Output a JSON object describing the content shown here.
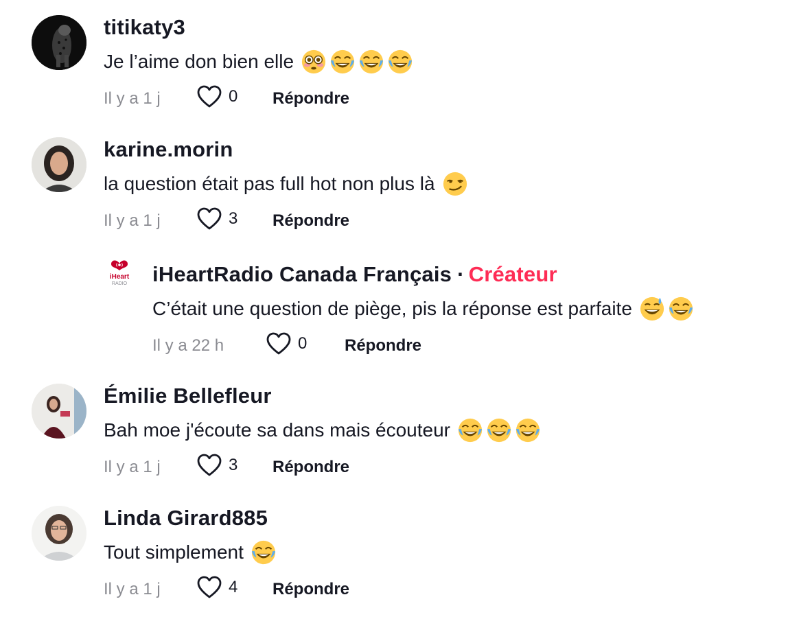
{
  "comments": [
    {
      "username": "titikaty3",
      "text": "Je l’aime don bien elle",
      "emojis": [
        "flushed-face",
        "face-with-tears-of-joy",
        "face-with-tears-of-joy",
        "face-with-tears-of-joy"
      ],
      "time": "Il y a 1 j",
      "likes": "0",
      "reply_label": "Répondre"
    },
    {
      "username": "karine.morin",
      "text": "la question était pas full hot non plus là",
      "emojis": [
        "smirking-face"
      ],
      "time": "Il y a 1 j",
      "likes": "3",
      "reply_label": "Répondre",
      "replies": [
        {
          "username": "iHeartRadio Canada Français",
          "separator": "·",
          "badge": "Créateur",
          "avatar_text": "iHeart",
          "avatar_subtext": "RADIO",
          "text": "C’était une question de piège, pis la réponse est parfaite",
          "emojis": [
            "grinning-face-with-sweat",
            "face-with-tears-of-joy"
          ],
          "time": "Il y a 22 h",
          "likes": "0",
          "reply_label": "Répondre"
        }
      ]
    },
    {
      "username": "Émilie Bellefleur",
      "text": "Bah moe j'écoute sa dans mais écouteur",
      "emojis": [
        "face-with-tears-of-joy",
        "face-with-tears-of-joy",
        "face-with-tears-of-joy"
      ],
      "time": "Il y a 1 j",
      "likes": "3",
      "reply_label": "Répondre"
    },
    {
      "username": "Linda Girard885",
      "text": "Tout simplement",
      "emojis": [
        "face-with-tears-of-joy"
      ],
      "time": "Il y a 1 j",
      "likes": "4",
      "reply_label": "Répondre"
    }
  ],
  "colors": {
    "text": "#161823",
    "muted": "#8a8b91",
    "creator_badge": "#fe2c55",
    "iheart_red": "#c6002b"
  }
}
